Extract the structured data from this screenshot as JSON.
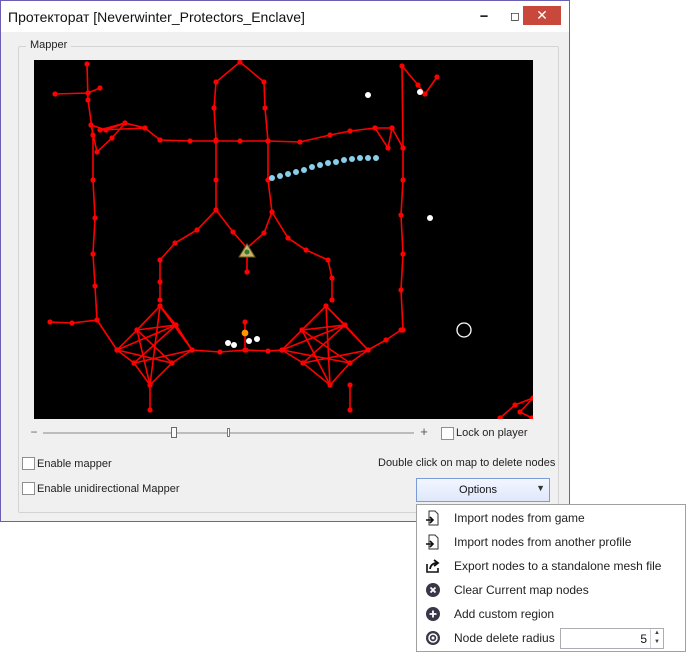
{
  "window": {
    "title": "Протекторат [Neverwinter_Protectors_Enclave]",
    "minimize_glyph": "🗕",
    "maximize_glyph": "◻",
    "close_glyph": "✕",
    "border_color": "#6b5fb5",
    "close_color": "#c8483c"
  },
  "mapper": {
    "group_label": "Mapper",
    "map_background": "#000000",
    "node_color": "#ff0000",
    "path_color": "#87ceeb",
    "zoom_minus": "−",
    "zoom_plus": "+",
    "lock_on_player_label": "Lock on player",
    "lock_on_player_checked": false,
    "enable_mapper_label": "Enable mapper",
    "enable_mapper_checked": false,
    "enable_unidirectional_label": "Enable unidirectional Mapper",
    "enable_unidirectional_checked": false,
    "hint": "Double click on map to delete nodes"
  },
  "options": {
    "label": "Options",
    "arrow": "▼",
    "menu": [
      {
        "label": "Import nodes from game",
        "icon": "import-icon"
      },
      {
        "label": "Import nodes from another profile",
        "icon": "import-profile-icon"
      },
      {
        "label": "Export nodes to a standalone mesh file",
        "icon": "export-icon"
      },
      {
        "label": "Clear Current map nodes",
        "icon": "clear-icon"
      },
      {
        "label": "Add custom region",
        "icon": "add-icon"
      },
      {
        "label": "Node delete radius",
        "icon": "radius-icon",
        "value": "5"
      }
    ]
  }
}
